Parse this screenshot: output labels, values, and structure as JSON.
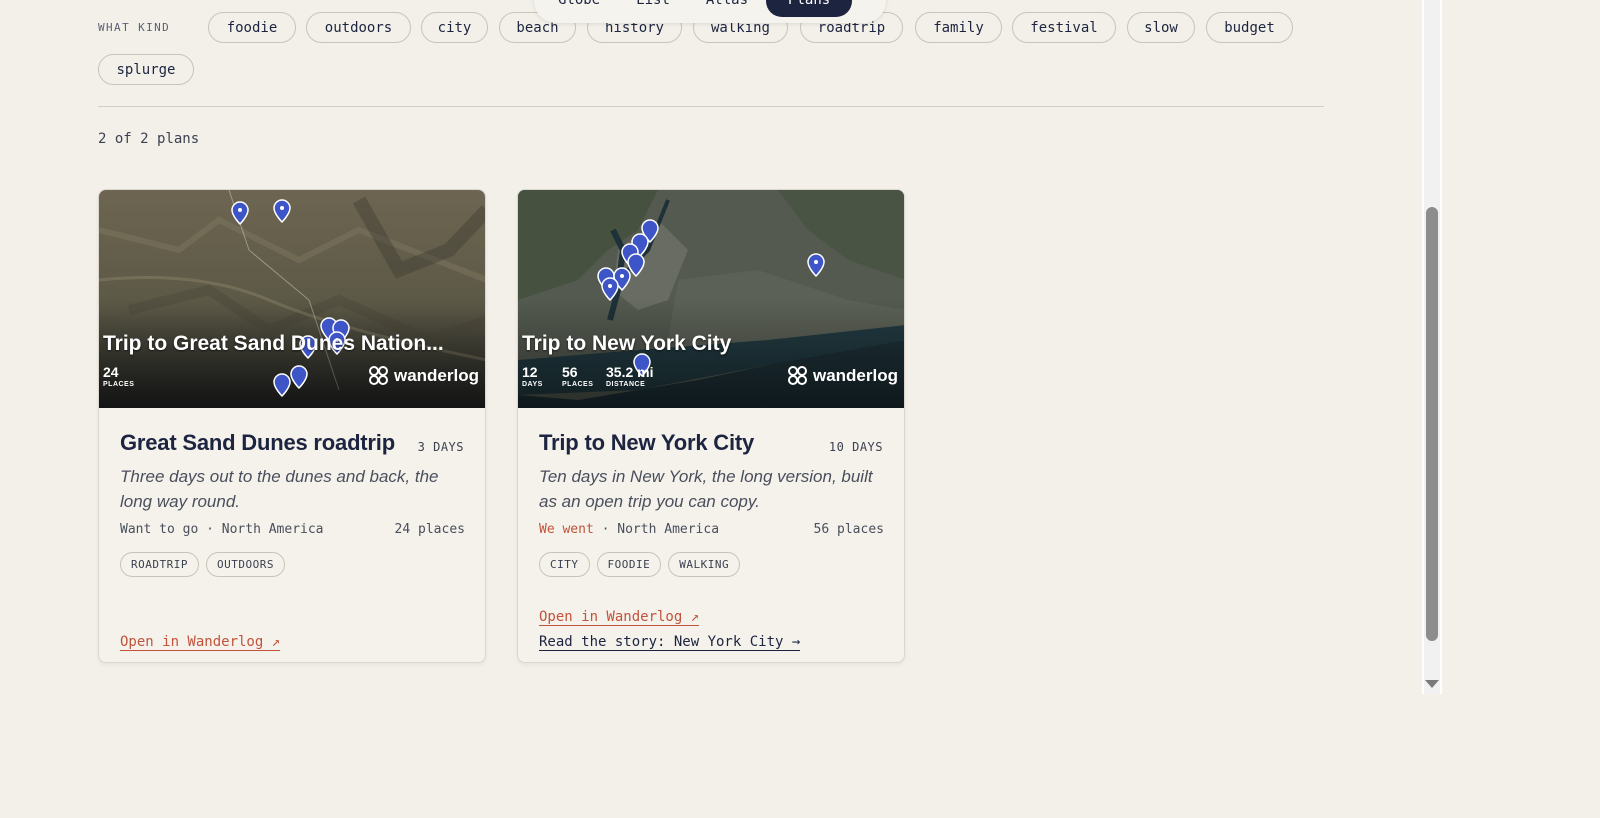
{
  "topnav": {
    "tabs": [
      "Globe",
      "List",
      "Atlas",
      "Plans"
    ],
    "active": "Plans"
  },
  "filters": {
    "label": "WHAT KIND",
    "chips": [
      "foodie",
      "outdoors",
      "city",
      "beach",
      "history",
      "walking",
      "roadtrip",
      "family",
      "festival",
      "slow",
      "budget",
      "splurge"
    ]
  },
  "results": {
    "count_text": "2 of 2 plans"
  },
  "cards": [
    {
      "map_title": "Trip to Great Sand Dunes Nation...",
      "map_stats": [
        {
          "value": "24",
          "label": "PLACES"
        }
      ],
      "brand": "wanderlog",
      "title": "Great Sand Dunes roadtrip",
      "days": "3 DAYS",
      "description": "Three days out to the dunes and back, the long way round.",
      "status": "Want to go",
      "separator": "·",
      "region": "North America",
      "places": "24 places",
      "tags": [
        "ROADTRIP",
        "OUTDOORS"
      ],
      "links": {
        "wanderlog": "Open in Wanderlog ↗"
      }
    },
    {
      "map_title": "Trip to New York City",
      "map_stats": [
        {
          "value": "12",
          "label": "DAYS"
        },
        {
          "value": "56",
          "label": "PLACES"
        },
        {
          "value": "35.2 mi",
          "label": "DISTANCE"
        }
      ],
      "brand": "wanderlog",
      "title": "Trip to New York City",
      "days": "10 DAYS",
      "description": "Ten days in New York, the long version, built as an open trip you can copy.",
      "status": "We went",
      "separator": "·",
      "region": "North America",
      "places": "56 places",
      "tags": [
        "CITY",
        "FOODIE",
        "WALKING"
      ],
      "links": {
        "wanderlog": "Open in Wanderlog ↗",
        "story": "Read the story: New York City →"
      }
    }
  ],
  "colors": {
    "background": "#f3f0e9",
    "navy": "#1c2440",
    "accent": "#c0533c",
    "pin": "#3e55c8"
  }
}
